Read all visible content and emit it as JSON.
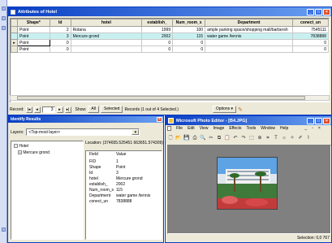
{
  "attributes": {
    "title": "Attributes of Hotel",
    "columns": [
      "Shape*",
      "Id",
      "hotel",
      "establish_",
      "Num_room_s",
      "Department",
      "conect_un"
    ],
    "rows": [
      {
        "shape": "Point",
        "id": "2",
        "hotel": "Rotana",
        "establish": "1999",
        "num_room": "100",
        "department": "ample parking space/shopping mall/barbersh",
        "conect": "7545111"
      },
      {
        "shape": "Point",
        "id": "3",
        "hotel": "Mercure grond",
        "establish": "2002",
        "num_room": "115",
        "department": "water game /tennis",
        "conect": "7838888"
      },
      {
        "shape": "Point",
        "id": "0",
        "hotel": "",
        "establish": "0",
        "num_room": "0",
        "department": "",
        "conect": "0"
      },
      {
        "shape": "Point",
        "id": "0",
        "hotel": "",
        "establish": "0",
        "num_room": "0",
        "department": "",
        "conect": "0"
      }
    ],
    "record_label": "Record:",
    "record_value": "3",
    "show_label": "Show:",
    "all_label": "All",
    "selected_label": "Selected",
    "records_text": "Records (1 out of 4 Selected.)",
    "options_label": "Options"
  },
  "identify": {
    "title": "Identify Results",
    "layers_label": "Layers:",
    "layers_value": "<Top-most layer>",
    "tree_root": "Hotel",
    "tree_child": "Mercure grond",
    "location": "Location: (374655.525451 663651.574309)",
    "field_header": "Field",
    "value_header": "Value",
    "fields": [
      {
        "f": "FID",
        "v": "1"
      },
      {
        "f": "Shape",
        "v": "Point"
      },
      {
        "f": "Id",
        "v": "3"
      },
      {
        "f": "hotel",
        "v": "Mercure grond"
      },
      {
        "f": "establish_",
        "v": "2002"
      },
      {
        "f": "Num_room_s",
        "v": "115"
      },
      {
        "f": "Department",
        "v": "water game /tennis"
      },
      {
        "f": "conect_un",
        "v": "7838888"
      }
    ]
  },
  "photo": {
    "title": "Microsoft Photo Editor - [B4.JPG]",
    "menu": [
      "File",
      "Edit",
      "View",
      "Image",
      "Effects",
      "Tools",
      "Window",
      "Help"
    ],
    "status": "Selection: 0,0 767"
  },
  "colors": {
    "titlebar": "#0a3fc4",
    "highlight_row": "#c9f0f0",
    "window_bg": "#ece9d8"
  }
}
